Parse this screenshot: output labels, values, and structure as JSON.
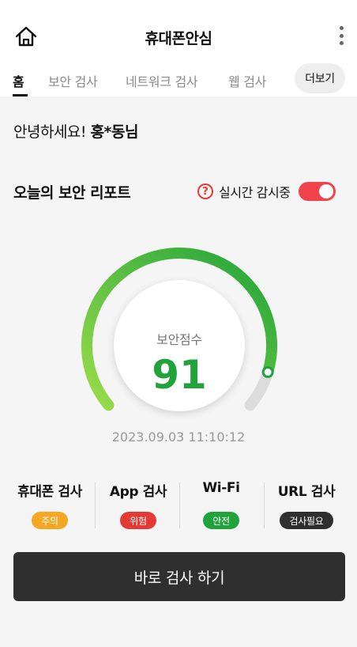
{
  "app": {
    "title": "휴대폰안심"
  },
  "tabs": [
    {
      "label": "홈",
      "active": true
    },
    {
      "label": "보안 검사",
      "active": false
    },
    {
      "label": "네트워크 검사",
      "active": false
    },
    {
      "label": "웹 검사",
      "active": false
    }
  ],
  "more_tab_label": "더보기",
  "greeting": {
    "prefix": "안녕하세요! ",
    "name": "홍*동님"
  },
  "report": {
    "title": "오늘의 보안 리포트",
    "realtime_label": "실시간 감시중",
    "realtime_on": true,
    "help_icon": "?"
  },
  "score": {
    "label": "보안점수",
    "value": "91",
    "fraction": 0.91,
    "color": "#1fa33a",
    "timestamp": "2023.09.03 11:10:12"
  },
  "checks": [
    {
      "label": "휴대폰 검사",
      "badge": "주의",
      "badge_color": "#f5a623"
    },
    {
      "label": "App 검사",
      "badge": "위험",
      "badge_color": "#e53935"
    },
    {
      "label": "Wi-Fi",
      "badge": "안전",
      "badge_color": "#1fa33a"
    },
    {
      "label": "URL 검사",
      "badge": "검사필요",
      "badge_color": "#2f2f2f"
    }
  ],
  "scan_button_label": "바로 검사 하기",
  "icons": {
    "home": "home-icon",
    "more": "more-vertical-icon",
    "help": "help-icon"
  },
  "colors": {
    "accent_red": "#f1434c",
    "gauge_start": "#9bdc4a",
    "gauge_end": "#1fa33a",
    "button_dark": "#2f2f2f"
  }
}
